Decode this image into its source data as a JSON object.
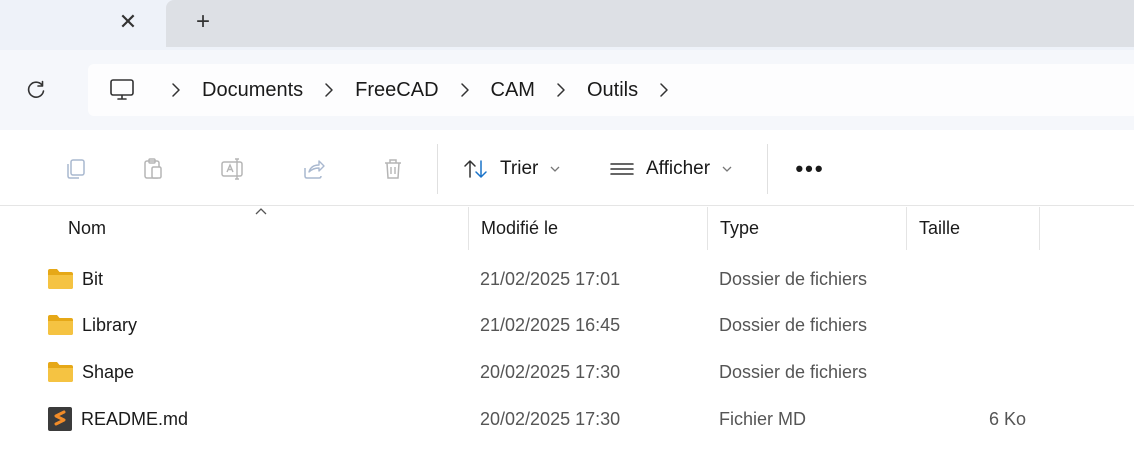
{
  "tabs": {
    "close_glyph": "✕",
    "new_tab_glyph": "+"
  },
  "breadcrumb": {
    "items": [
      "Documents",
      "FreeCAD",
      "CAM",
      "Outils"
    ]
  },
  "commandbar": {
    "sort_label": "Trier",
    "view_label": "Afficher",
    "more_glyph": "•••"
  },
  "columns": {
    "name": "Nom",
    "modified": "Modifié le",
    "type": "Type",
    "size": "Taille"
  },
  "files": [
    {
      "name": "Bit",
      "modified": "21/02/2025 17:01",
      "type": "Dossier de fichiers",
      "size": "",
      "icon": "folder-icon"
    },
    {
      "name": "Library",
      "modified": "21/02/2025 16:45",
      "type": "Dossier de fichiers",
      "size": "",
      "icon": "folder-icon"
    },
    {
      "name": "Shape",
      "modified": "20/02/2025 17:30",
      "type": "Dossier de fichiers",
      "size": "",
      "icon": "folder-icon"
    },
    {
      "name": "README.md",
      "modified": "20/02/2025 17:30",
      "type": "Fichier MD",
      "size": "6 Ko",
      "icon": "md-file-icon"
    }
  ],
  "colors": {
    "folder": "#f5c342",
    "folder_dark": "#e6a817",
    "md_bg": "#3b3b3b",
    "md_accent": "#f28c28"
  }
}
